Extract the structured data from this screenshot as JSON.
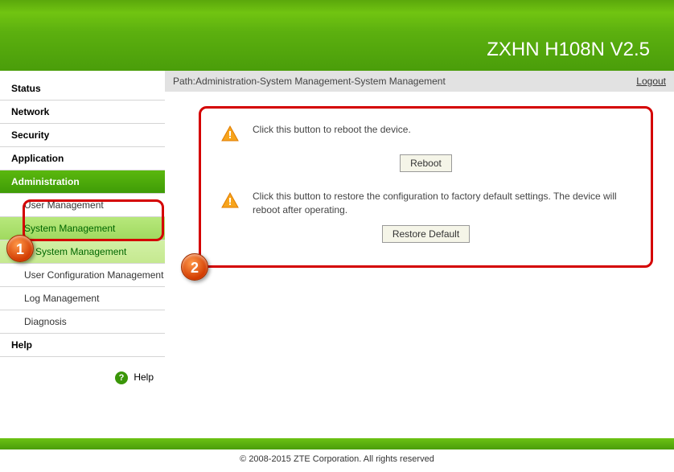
{
  "header": {
    "title": "ZXHN H108N V2.5"
  },
  "path": {
    "label": "Path:Administration-System Management-System Management",
    "logout": "Logout"
  },
  "sidebar": {
    "items": [
      {
        "label": "Status"
      },
      {
        "label": "Network"
      },
      {
        "label": "Security"
      },
      {
        "label": "Application"
      },
      {
        "label": "Administration"
      }
    ],
    "subs": [
      {
        "label": "User Management"
      },
      {
        "label": "System Management"
      },
      {
        "label": "System Management"
      },
      {
        "label": "User Configuration Management"
      },
      {
        "label": "Log Management"
      },
      {
        "label": "Diagnosis"
      }
    ],
    "help_section": "Help",
    "help_link": "Help"
  },
  "panel": {
    "reboot_text": "Click this button to reboot the device.",
    "reboot_btn": "Reboot",
    "restore_text": "Click this button to restore the configuration to factory default settings. The device will reboot after operating.",
    "restore_btn": "Restore Default"
  },
  "callouts": {
    "c1": "1",
    "c2": "2"
  },
  "footer": "© 2008-2015 ZTE Corporation. All rights reserved"
}
